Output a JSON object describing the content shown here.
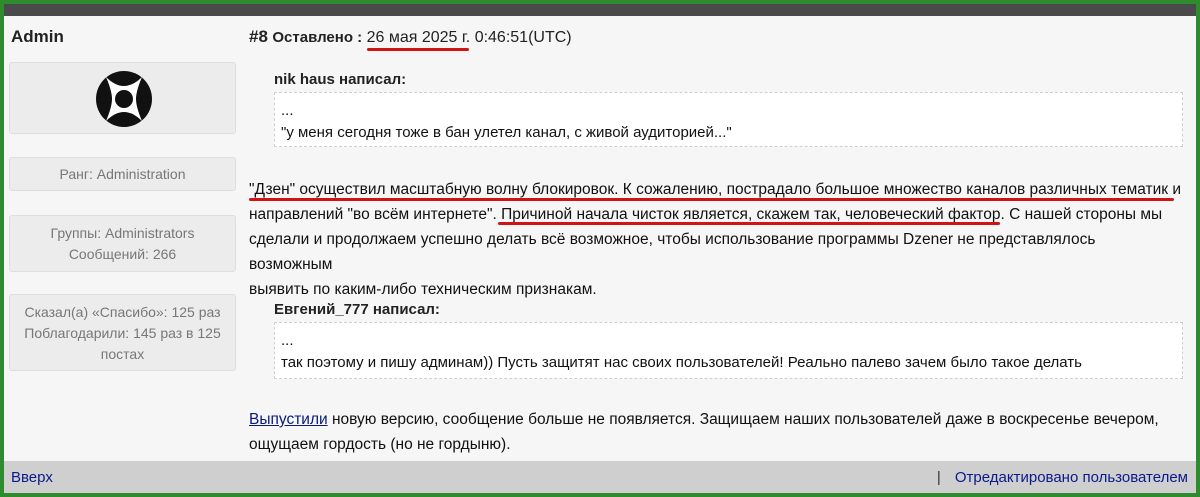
{
  "sidebar": {
    "author_name": "Admin",
    "rank": "Ранг: Administration",
    "groups": "Группы: Administrators",
    "messages": "Сообщений: 266",
    "thanks_said": "Сказал(а) «Спасибо»: 125 раз",
    "thanked_line1": "Поблагодарили: 145 раз в 125",
    "thanked_line2": "постах"
  },
  "post": {
    "number": "#8",
    "posted_label": "Оставлено :",
    "date": "26 мая 2025 г.",
    "time": "0:46:51(UTC)",
    "quote1": {
      "author": "nik haus написал:",
      "line1": "...",
      "line2": "\"у меня сегодня тоже в бан улетел канал, с живой аудиторией...\""
    },
    "paragraph1": {
      "line1": "\"Дзен\" осуществил масштабную волну блокировок. К сожалению, пострадало большое множество каналов различных тематик и",
      "line2_a": "направлений \"во всём интернете\". ",
      "line2_b": "Причиной начала чисток является, скажем так, человеческий фактор.",
      "line2_c": " С нашей стороны мы",
      "line3": "сделали и продолжаем успешно делать всё возможное, чтобы использование программы Dzener не представлялось возможным",
      "line4": "выявить по каким-либо техническим признакам."
    },
    "quote2": {
      "author": "Евгений_777 написал:",
      "line1": "...",
      "line2": "так поэтому и пишу админам)) Пусть защитят нас своих пользователей! Реально палево зачем было такое делать"
    },
    "paragraph2": {
      "link": "Выпустили",
      "line1_rest": " новую версию, сообщение больше не появляется. Защищаем наших пользователей даже в воскресенье вечером,",
      "line2": "ощущаем гордость (но не гордыню)."
    }
  },
  "footer": {
    "top_link": "Вверх",
    "separator": "|",
    "edited_link": "Отредактировано пользователем"
  },
  "colors": {
    "frame_green": "#2e8b2e",
    "underline_red": "#d01414",
    "link_blue": "#0a1a7a"
  }
}
